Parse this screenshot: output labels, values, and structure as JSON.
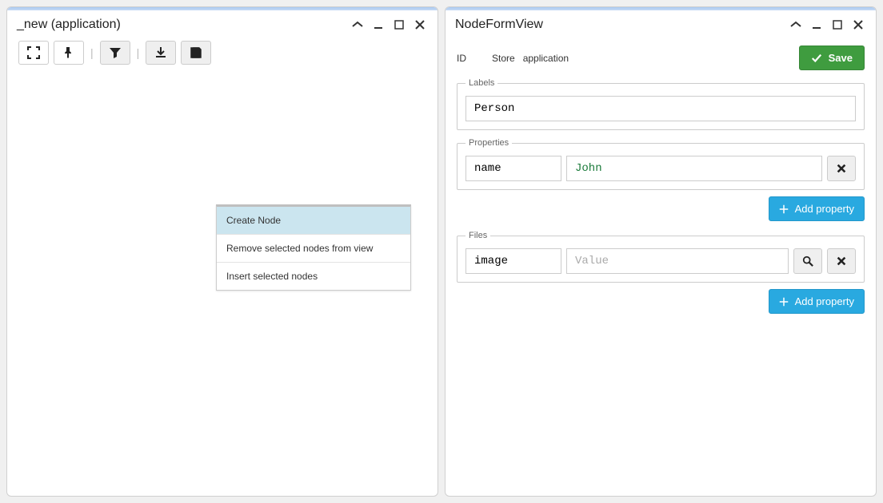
{
  "left": {
    "title": "_new (application)",
    "context_menu": {
      "items": [
        {
          "label": "Create Node",
          "selected": true
        },
        {
          "label": "Remove selected nodes from view",
          "selected": false
        },
        {
          "label": "Insert selected nodes",
          "selected": false
        }
      ]
    }
  },
  "right": {
    "title": "NodeFormView",
    "info": {
      "id_label": "ID",
      "store_label": "Store",
      "store_value": "application",
      "save_label": "Save"
    },
    "labels": {
      "legend": "Labels",
      "value": "Person"
    },
    "properties": {
      "legend": "Properties",
      "rows": [
        {
          "key": "name",
          "value": "John"
        }
      ],
      "add_label": "Add property"
    },
    "files": {
      "legend": "Files",
      "rows": [
        {
          "key": "image",
          "placeholder": "Value"
        }
      ],
      "add_label": "Add property"
    }
  }
}
